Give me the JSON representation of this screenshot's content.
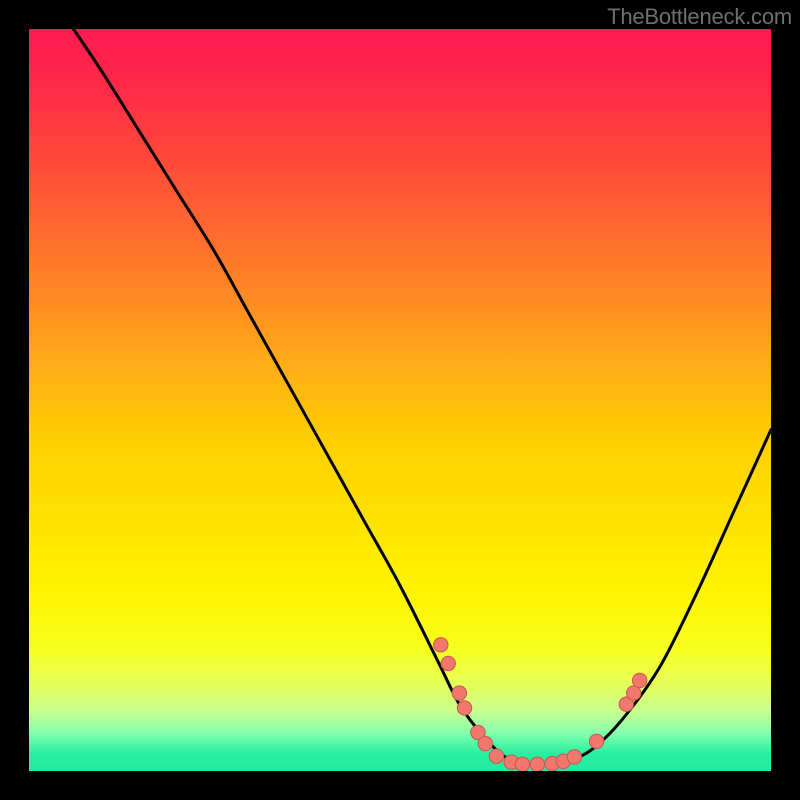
{
  "watermark": {
    "text": "TheBottleneck.com"
  },
  "colors": {
    "curve": "#000000",
    "dot_fill": "#f2786d",
    "dot_stroke": "#c9564d",
    "background": "#000000",
    "gradient_top": "#ff1a50",
    "gradient_bottom": "#23e8a2"
  },
  "chart_data": {
    "type": "line",
    "title": "",
    "xlabel": "",
    "ylabel": "",
    "xlim": [
      0,
      100
    ],
    "ylim": [
      0,
      100
    ],
    "grid": false,
    "series": [
      {
        "name": "curve",
        "x": [
          6,
          10,
          15,
          20,
          25,
          30,
          35,
          40,
          45,
          50,
          55,
          58,
          61,
          64,
          67,
          70,
          73,
          76,
          80,
          85,
          90,
          95,
          100
        ],
        "y": [
          100,
          94,
          86,
          78,
          70,
          61,
          52,
          43,
          34,
          25,
          15,
          9,
          5,
          2,
          1,
          1,
          1.5,
          3,
          7,
          14,
          24,
          35,
          46
        ]
      }
    ],
    "scatter": [
      {
        "x": 55.5,
        "y": 17.0
      },
      {
        "x": 56.5,
        "y": 14.5
      },
      {
        "x": 58.0,
        "y": 10.5
      },
      {
        "x": 58.7,
        "y": 8.5
      },
      {
        "x": 60.5,
        "y": 5.2
      },
      {
        "x": 61.5,
        "y": 3.7
      },
      {
        "x": 63.0,
        "y": 2.0
      },
      {
        "x": 65.0,
        "y": 1.2
      },
      {
        "x": 66.5,
        "y": 0.9
      },
      {
        "x": 68.5,
        "y": 0.9
      },
      {
        "x": 70.5,
        "y": 1.0
      },
      {
        "x": 72.0,
        "y": 1.3
      },
      {
        "x": 73.5,
        "y": 1.9
      },
      {
        "x": 76.5,
        "y": 4.0
      },
      {
        "x": 80.5,
        "y": 9.0
      },
      {
        "x": 81.5,
        "y": 10.5
      },
      {
        "x": 82.3,
        "y": 12.2
      }
    ]
  }
}
